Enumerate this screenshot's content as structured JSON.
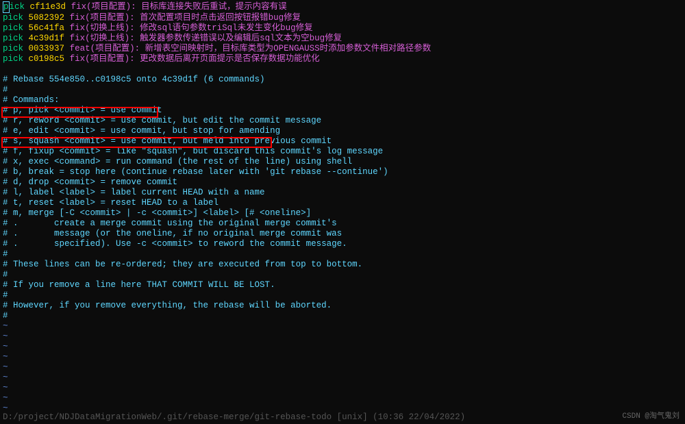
{
  "commits": [
    {
      "action": "pick",
      "hash": "cf11e3d",
      "msg": "fix(项目配置): 目标库连接失败后重试，提示内容有误"
    },
    {
      "action": "pick",
      "hash": "5082392",
      "msg": "fix(项目配置): 首次配置项目时点击返回按钮报错bug修复"
    },
    {
      "action": "pick",
      "hash": "56c41fa",
      "msg": "fix(切换上线): 修改sql语句参数triSql未发生变化bug修复"
    },
    {
      "action": "pick",
      "hash": "4c39d1f",
      "msg": "fix(切换上线): 触发器参数传递错误以及编辑后sql文本为空bug修复"
    },
    {
      "action": "pick",
      "hash": "0033937",
      "msg": "feat(项目配置): 新增表空间映射时，目标库类型为OPENGAUSS时添加参数文件相对路径参数"
    },
    {
      "action": "pick",
      "hash": "c0198c5",
      "msg": "fix(项目配置): 更改数据后离开页面提示是否保存数据功能优化"
    }
  ],
  "comments": {
    "blank1": "#",
    "rebase_header": "# Rebase 554e850..c0198c5 onto 4c39d1f (6 commands)",
    "blank2": "#",
    "commands_label": "# Commands:",
    "pick": "# p, pick <commit> = use commit",
    "reword": "# r, reword <commit> = use commit, but edit the commit message",
    "edit": "# e, edit <commit> = use commit, but stop for amending",
    "squash": "# s, squash <commit> = use commit, but meld into previous commit",
    "fixup": "# f, fixup <commit> = like \"squash\", but discard this commit's log message",
    "exec": "# x, exec <command> = run command (the rest of the line) using shell",
    "break": "# b, break = stop here (continue rebase later with 'git rebase --continue')",
    "drop": "# d, drop <commit> = remove commit",
    "label": "# l, label <label> = label current HEAD with a name",
    "reset": "# t, reset <label> = reset HEAD to a label",
    "merge": "# m, merge [-C <commit> | -c <commit>] <label> [# <oneline>]",
    "merge1": "# .       create a merge commit using the original merge commit's",
    "merge2": "# .       message (or the oneline, if no original merge commit was",
    "merge3": "# .       specified). Use -c <commit> to reword the commit message.",
    "blank3": "#",
    "reorder": "# These lines can be re-ordered; they are executed from top to bottom.",
    "blank4": "#",
    "remove": "# If you remove a line here THAT COMMIT WILL BE LOST.",
    "blank5": "#",
    "abort": "# However, if you remove everything, the rebase will be aborted.",
    "blank6": "#"
  },
  "tilde": "~",
  "status": "D:/project/NDJDataMigrationWeb/.git/rebase-merge/git-rebase-todo [unix] (10:36 22/04/2022)",
  "watermark": "CSDN @淘气鬼刘"
}
